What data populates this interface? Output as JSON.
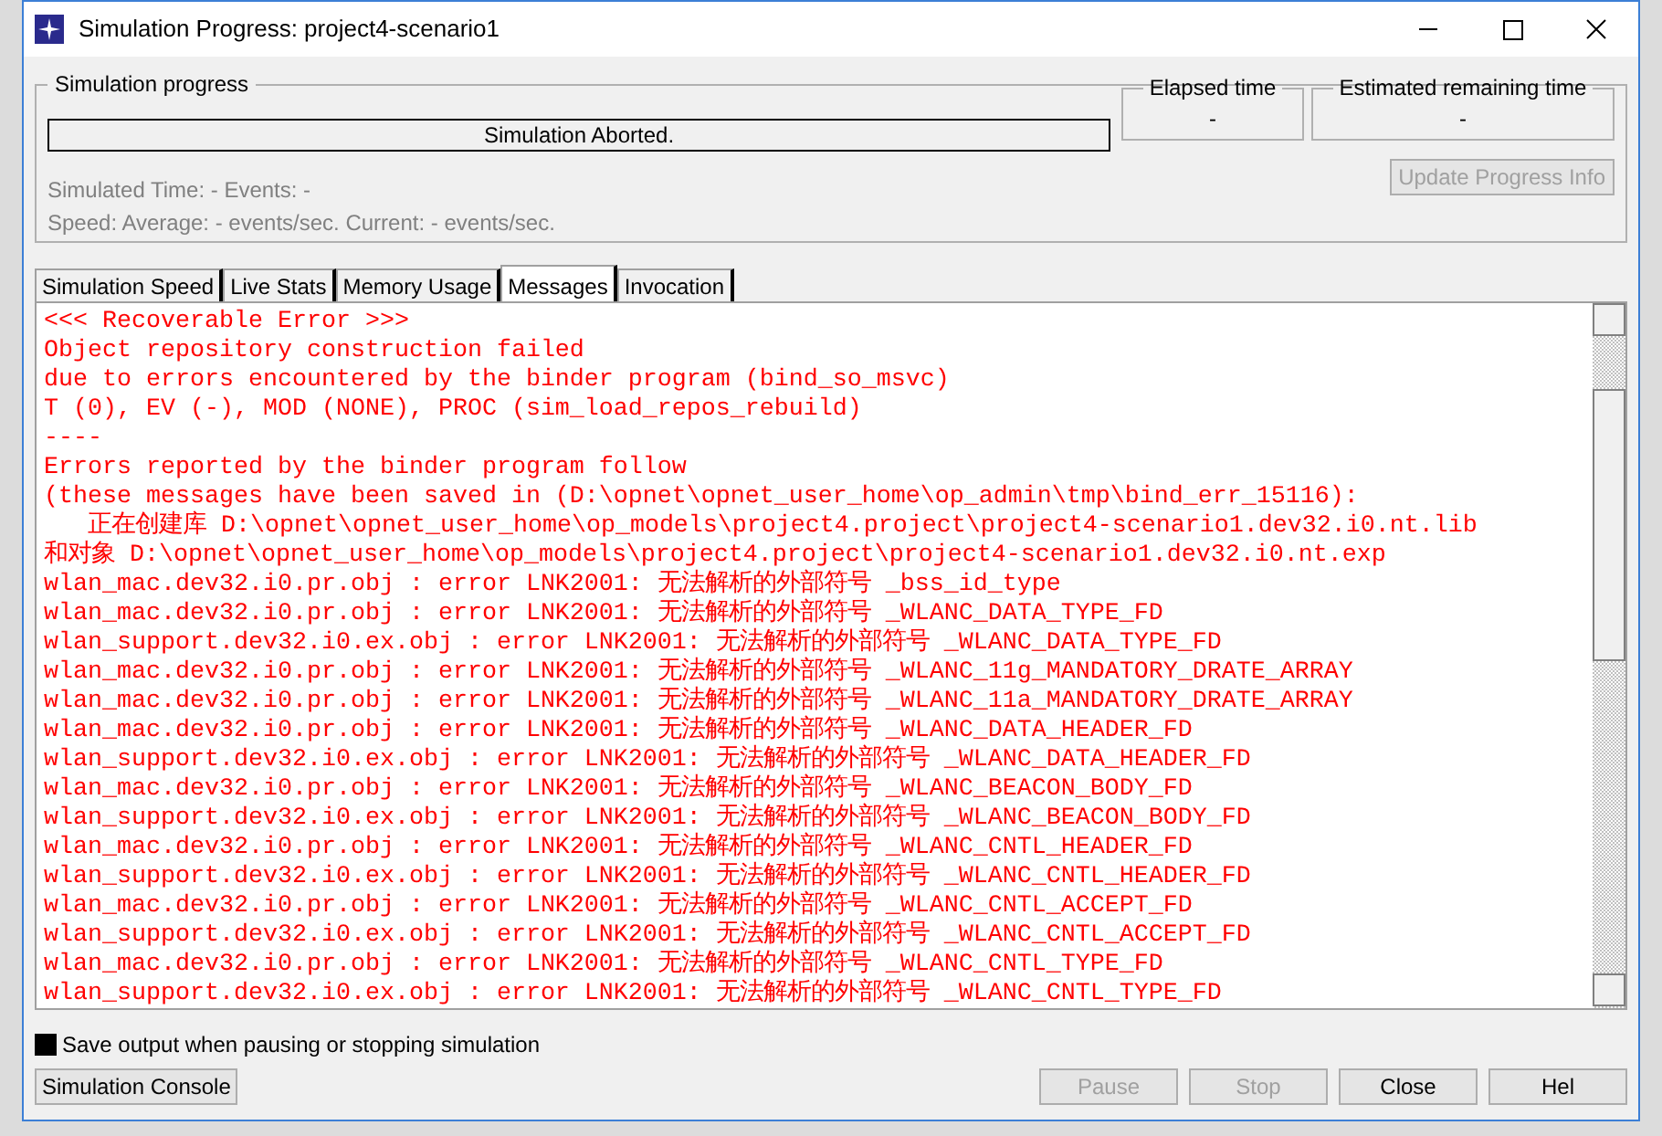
{
  "window": {
    "title": "Simulation Progress: project4-scenario1"
  },
  "progress_group": {
    "title": "Simulation progress",
    "status": "Simulation Aborted.",
    "simulated_line": "Simulated Time: - Events: -",
    "speed_line": "Speed: Average: - events/sec. Current: - events/sec."
  },
  "elapsed": {
    "title": "Elapsed time",
    "value": "-"
  },
  "remaining": {
    "title": "Estimated remaining time",
    "value": "-"
  },
  "update_button": {
    "label": "Update Progress Info",
    "disabled": true
  },
  "tabs": [
    {
      "label": "Simulation Speed",
      "selected": false
    },
    {
      "label": "Live Stats",
      "selected": false
    },
    {
      "label": "Memory Usage",
      "selected": false
    },
    {
      "label": "Messages",
      "selected": true
    },
    {
      "label": "Invocation",
      "selected": false
    }
  ],
  "messages": [
    "<<< Recoverable Error >>>",
    "Object repository construction failed",
    "due to errors encountered by the binder program (bind_so_msvc)",
    "T (0), EV (-), MOD (NONE), PROC (sim_load_repos_rebuild)",
    "----",
    "Errors reported by the binder program follow",
    "(these messages have been saved in (D:\\opnet\\opnet_user_home\\op_admin\\tmp\\bind_err_15116):",
    "   正在创建库 D:\\opnet\\opnet_user_home\\op_models\\project4.project\\project4-scenario1.dev32.i0.nt.lib",
    "和对象 D:\\opnet\\opnet_user_home\\op_models\\project4.project\\project4-scenario1.dev32.i0.nt.exp",
    "wlan_mac.dev32.i0.pr.obj : error LNK2001: 无法解析的外部符号 _bss_id_type",
    "wlan_mac.dev32.i0.pr.obj : error LNK2001: 无法解析的外部符号 _WLANC_DATA_TYPE_FD",
    "wlan_support.dev32.i0.ex.obj : error LNK2001: 无法解析的外部符号 _WLANC_DATA_TYPE_FD",
    "wlan_mac.dev32.i0.pr.obj : error LNK2001: 无法解析的外部符号 _WLANC_11g_MANDATORY_DRATE_ARRAY",
    "wlan_mac.dev32.i0.pr.obj : error LNK2001: 无法解析的外部符号 _WLANC_11a_MANDATORY_DRATE_ARRAY",
    "wlan_mac.dev32.i0.pr.obj : error LNK2001: 无法解析的外部符号 _WLANC_DATA_HEADER_FD",
    "wlan_support.dev32.i0.ex.obj : error LNK2001: 无法解析的外部符号 _WLANC_DATA_HEADER_FD",
    "wlan_mac.dev32.i0.pr.obj : error LNK2001: 无法解析的外部符号 _WLANC_BEACON_BODY_FD",
    "wlan_support.dev32.i0.ex.obj : error LNK2001: 无法解析的外部符号 _WLANC_BEACON_BODY_FD",
    "wlan_mac.dev32.i0.pr.obj : error LNK2001: 无法解析的外部符号 _WLANC_CNTL_HEADER_FD",
    "wlan_support.dev32.i0.ex.obj : error LNK2001: 无法解析的外部符号 _WLANC_CNTL_HEADER_FD",
    "wlan_mac.dev32.i0.pr.obj : error LNK2001: 无法解析的外部符号 _WLANC_CNTL_ACCEPT_FD",
    "wlan_support.dev32.i0.ex.obj : error LNK2001: 无法解析的外部符号 _WLANC_CNTL_ACCEPT_FD",
    "wlan_mac.dev32.i0.pr.obj : error LNK2001: 无法解析的外部符号 _WLANC_CNTL_TYPE_FD",
    "wlan_support.dev32.i0.ex.obj : error LNK2001: 无法解析的外部符号 _WLANC_CNTL_TYPE_FD"
  ],
  "save_output": {
    "label": "Save output when pausing or stopping simulation",
    "checked": true
  },
  "console_button": {
    "label": "Simulation Console"
  },
  "buttons": [
    {
      "label": "Pause",
      "disabled": true
    },
    {
      "label": "Stop",
      "disabled": true
    },
    {
      "label": "Close",
      "disabled": false
    },
    {
      "label": "Hel",
      "disabled": false
    }
  ]
}
